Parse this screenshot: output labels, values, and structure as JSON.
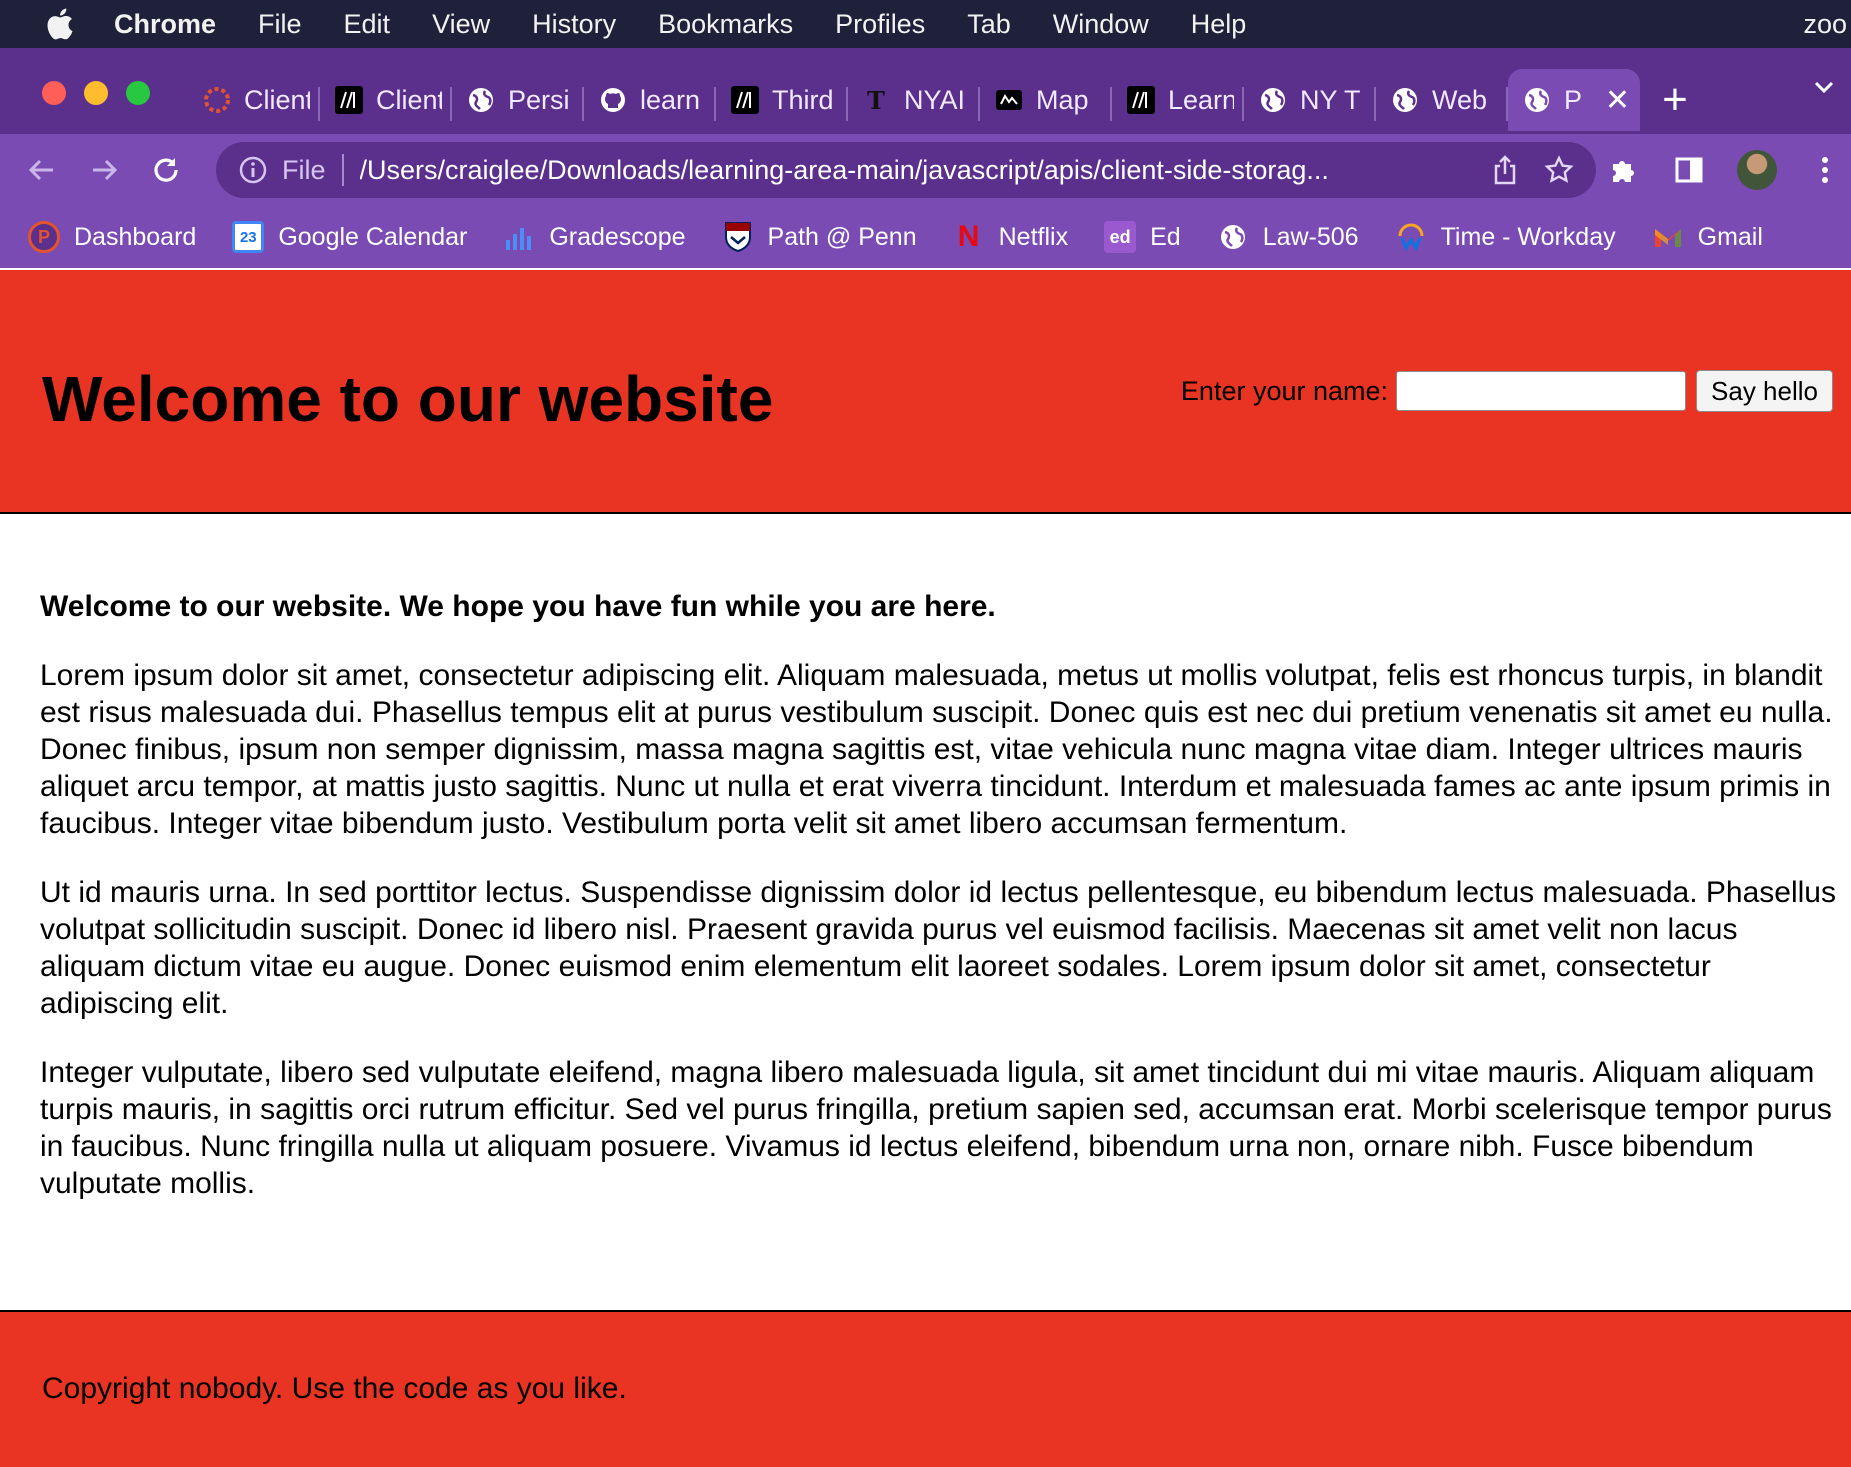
{
  "menubar": {
    "items": [
      "Chrome",
      "File",
      "Edit",
      "View",
      "History",
      "Bookmarks",
      "Profiles",
      "Tab",
      "Window",
      "Help"
    ],
    "right_text": "zoo"
  },
  "tabs": [
    {
      "label": "Client",
      "icon": "canvas-icon"
    },
    {
      "label": "Client",
      "icon": "mdn-icon"
    },
    {
      "label": "Persi",
      "icon": "globe-icon"
    },
    {
      "label": "learn",
      "icon": "github-icon"
    },
    {
      "label": "Third",
      "icon": "mdn-icon"
    },
    {
      "label": "NYAI",
      "icon": "nyt-icon"
    },
    {
      "label": "Map",
      "icon": "map-icon"
    },
    {
      "label": "Learn",
      "icon": "mdn-icon"
    },
    {
      "label": "NY T",
      "icon": "globe-icon"
    },
    {
      "label": "Web",
      "icon": "globe-icon"
    },
    {
      "label": "P",
      "icon": "globe-icon",
      "active": true
    }
  ],
  "toolbar": {
    "scheme": "File",
    "url": "/Users/craiglee/Downloads/learning-area-main/javascript/apis/client-side-storag..."
  },
  "bookmarks": [
    {
      "label": "Dashboard",
      "icon": "canvas-dashboard-icon"
    },
    {
      "label": "Google Calendar",
      "icon": "google-calendar-icon",
      "glyph": "23"
    },
    {
      "label": "Gradescope",
      "icon": "gradescope-icon"
    },
    {
      "label": "Path @ Penn",
      "icon": "penn-shield-icon"
    },
    {
      "label": "Netflix",
      "icon": "netflix-icon",
      "glyph": "N"
    },
    {
      "label": "Ed",
      "icon": "ed-icon",
      "glyph": "ed"
    },
    {
      "label": "Law-506",
      "icon": "globe-icon"
    },
    {
      "label": "Time - Workday",
      "icon": "workday-icon"
    },
    {
      "label": "Gmail",
      "icon": "gmail-icon",
      "glyph": "M"
    }
  ],
  "page": {
    "title": "Welcome to our website",
    "form_label": "Enter your name:",
    "input_value": "",
    "button_label": "Say hello",
    "lead": "Welcome to our website. We hope you have fun while you are here.",
    "paragraphs": [
      "Lorem ipsum dolor sit amet, consectetur adipiscing elit. Aliquam malesuada, metus ut mollis volutpat, felis est rhoncus turpis, in blandit est risus malesuada dui. Phasellus tempus elit at purus vestibulum suscipit. Donec quis est nec dui pretium venenatis sit amet eu nulla. Donec finibus, ipsum non semper dignissim, massa magna sagittis est, vitae vehicula nunc magna vitae diam. Integer ultrices mauris aliquet arcu tempor, at mattis justo sagittis. Nunc ut nulla et erat viverra tincidunt. Interdum et malesuada fames ac ante ipsum primis in faucibus. Integer vitae bibendum justo. Vestibulum porta velit sit amet libero accumsan fermentum.",
      "Ut id mauris urna. In sed porttitor lectus. Suspendisse dignissim dolor id lectus pellentesque, eu bibendum lectus malesuada. Phasellus volutpat sollicitudin suscipit. Donec id libero nisl. Praesent gravida purus vel euismod facilisis. Maecenas sit amet velit non lacus aliquam dictum vitae eu augue. Donec euismod enim elementum elit laoreet sodales. Lorem ipsum dolor sit amet, consectetur adipiscing elit.",
      "Integer vulputate, libero sed vulputate eleifend, magna libero malesuada ligula, sit amet tincidunt dui mi vitae mauris. Aliquam aliquam turpis mauris, in sagittis orci rutrum efficitur. Sed vel purus fringilla, pretium sapien sed, accumsan erat. Morbi scelerisque tempor purus in faucibus. Nunc fringilla nulla ut aliquam posuere. Vivamus id lectus eleifend, bibendum urna non, ornare nibh. Fusce bibendum vulputate mollis."
    ],
    "footer": "Copyright nobody. Use the code as you like."
  },
  "colors": {
    "header_red": "#e93424",
    "browser_purple": "#7a4bb2",
    "tabstrip_purple": "#5b2f8c",
    "menubar": "#1e2139"
  }
}
